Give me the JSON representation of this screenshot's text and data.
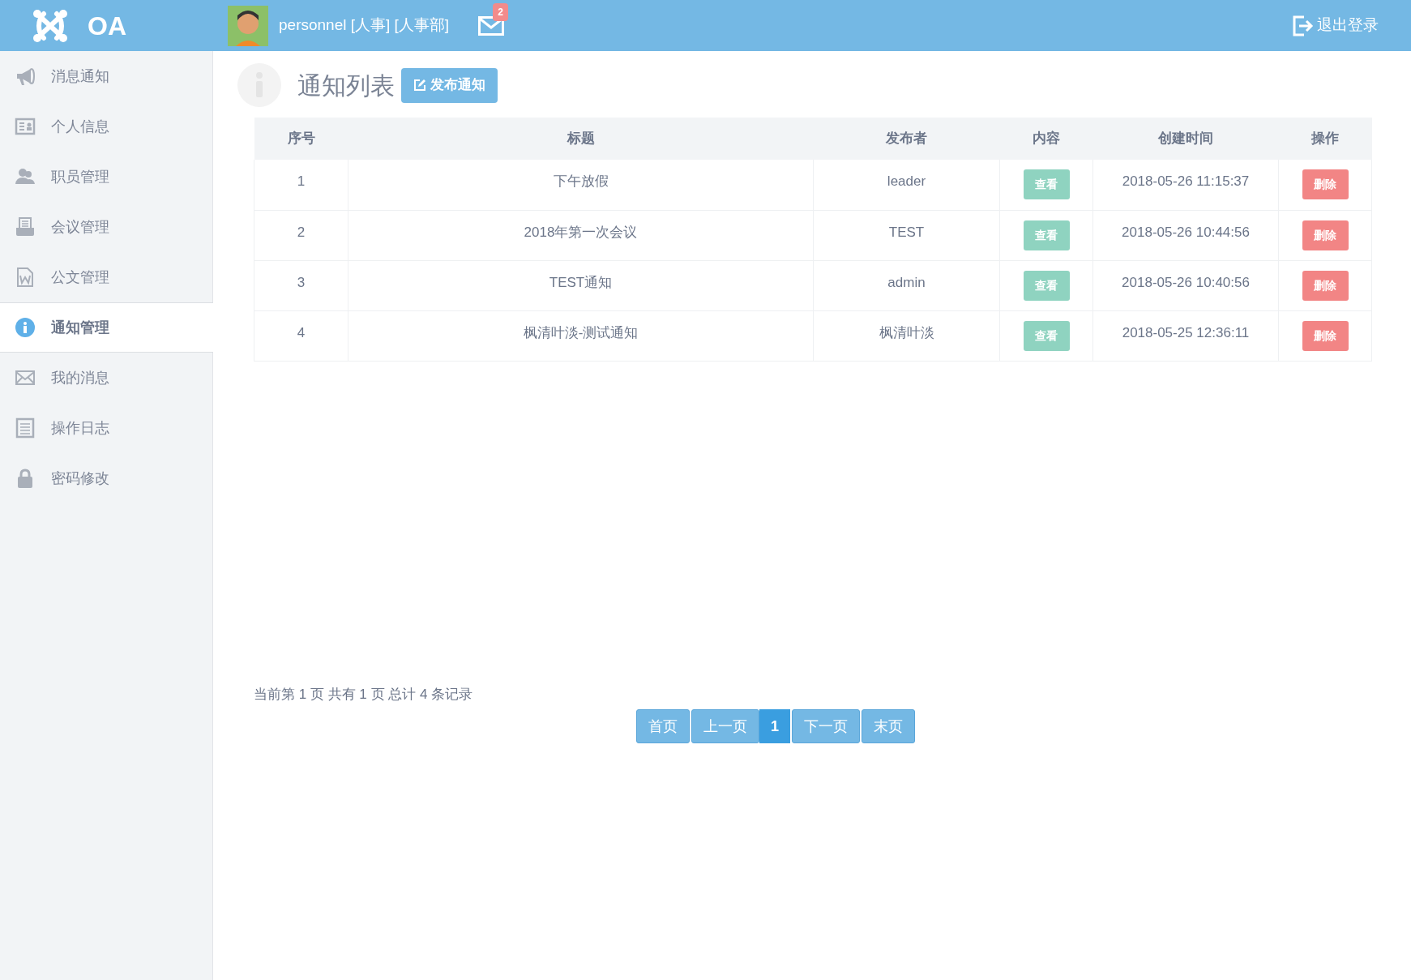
{
  "header": {
    "logo": "OA",
    "user": "personnel [人事] [人事部]",
    "mail_count": "2",
    "logout": "退出登录"
  },
  "sidebar": {
    "items": [
      {
        "label": "消息通知",
        "selected": false
      },
      {
        "label": "个人信息",
        "selected": false
      },
      {
        "label": "职员管理",
        "selected": false
      },
      {
        "label": "会议管理",
        "selected": false
      },
      {
        "label": "公文管理",
        "selected": false
      },
      {
        "label": "通知管理",
        "selected": true
      },
      {
        "label": "我的消息",
        "selected": false
      },
      {
        "label": "操作日志",
        "selected": false
      },
      {
        "label": "密码修改",
        "selected": false
      }
    ]
  },
  "page": {
    "title": "通知列表",
    "publish_button": "发布通知"
  },
  "table": {
    "columns": [
      "序号",
      "标题",
      "发布者",
      "内容",
      "创建时间",
      "操作"
    ],
    "rows": [
      {
        "no": "1",
        "title": "下午放假",
        "publisher": "leader",
        "view": "查看",
        "created": "2018-05-26 11:15:37",
        "delete": "删除"
      },
      {
        "no": "2",
        "title": "2018年第一次会议",
        "publisher": "TEST",
        "view": "查看",
        "created": "2018-05-26 10:44:56",
        "delete": "删除"
      },
      {
        "no": "3",
        "title": "TEST通知",
        "publisher": "admin",
        "view": "查看",
        "created": "2018-05-26 10:40:56",
        "delete": "删除"
      },
      {
        "no": "4",
        "title": "枫清叶淡-测试通知",
        "publisher": "枫清叶淡",
        "view": "查看",
        "created": "2018-05-25 12:36:11",
        "delete": "删除"
      }
    ]
  },
  "pagination": {
    "summary": "当前第 1 页 共有 1 页 总计 4 条记录",
    "buttons": [
      {
        "label": "首页",
        "selected": false
      },
      {
        "label": "上一页",
        "selected": false
      },
      {
        "label": "1",
        "selected": true
      },
      {
        "label": "下一页",
        "selected": false
      },
      {
        "label": "末页",
        "selected": false
      }
    ]
  }
}
